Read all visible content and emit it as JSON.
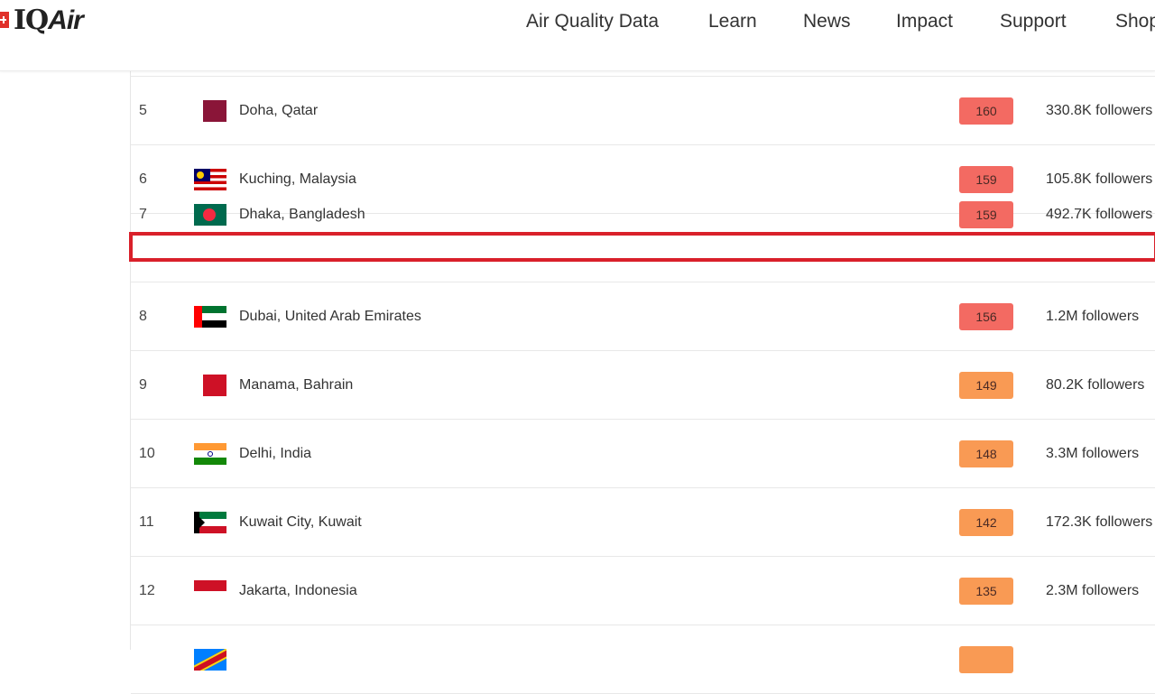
{
  "brand": {
    "logo_text_a": "IQ",
    "logo_text_b": "Air",
    "accent_color": "#e0302a"
  },
  "nav": {
    "items": [
      {
        "label": "Air Quality Data"
      },
      {
        "label": "Learn"
      },
      {
        "label": "News"
      },
      {
        "label": "Impact"
      },
      {
        "label": "Support"
      },
      {
        "label": "Shop"
      }
    ]
  },
  "rankings": {
    "rows": [
      {
        "rank": "5",
        "city": "Doha, Qatar",
        "aqi": "160",
        "followers": "330.8K followers",
        "flag": "qatar-flag-icon",
        "level_color": "#f36a62"
      },
      {
        "rank": "6",
        "city": "Kuching, Malaysia",
        "aqi": "159",
        "followers": "105.8K followers",
        "flag": "malaysia-flag-icon",
        "level_color": "#f36a62"
      },
      {
        "rank": "7",
        "city": "Dhaka, Bangladesh",
        "aqi": "159",
        "followers": "492.7K followers",
        "flag": "bangladesh-flag-icon",
        "level_color": "#f36a62",
        "highlighted": true
      },
      {
        "rank": "8",
        "city": "Dubai, United Arab Emirates",
        "aqi": "156",
        "followers": "1.2M followers",
        "flag": "uae-flag-icon",
        "level_color": "#f36a62"
      },
      {
        "rank": "9",
        "city": "Manama, Bahrain",
        "aqi": "149",
        "followers": "80.2K followers",
        "flag": "bahrain-flag-icon",
        "level_color": "#f99a54"
      },
      {
        "rank": "10",
        "city": "Delhi, India",
        "aqi": "148",
        "followers": "3.3M followers",
        "flag": "india-flag-icon",
        "level_color": "#f99a54"
      },
      {
        "rank": "11",
        "city": "Kuwait City, Kuwait",
        "aqi": "142",
        "followers": "172.3K followers",
        "flag": "kuwait-flag-icon",
        "level_color": "#f99a54"
      },
      {
        "rank": "12",
        "city": "Jakarta, Indonesia",
        "aqi": "135",
        "followers": "2.3M followers",
        "flag": "indonesia-flag-icon",
        "level_color": "#f99a54"
      }
    ]
  },
  "highlight_color": "#d9202a"
}
